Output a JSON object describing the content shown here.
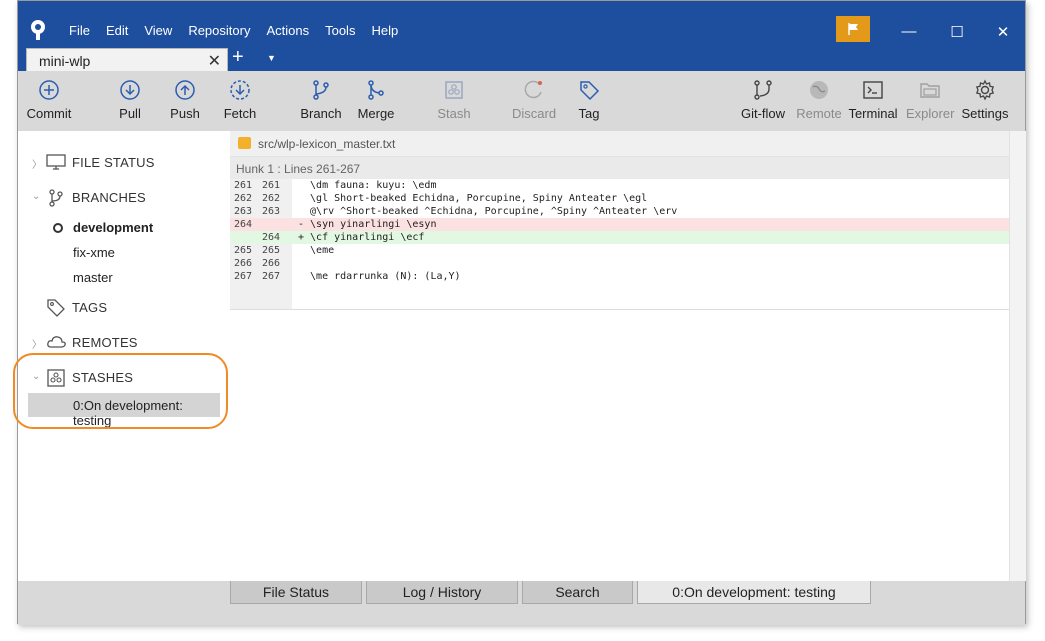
{
  "menu": [
    "File",
    "Edit",
    "View",
    "Repository",
    "Actions",
    "Tools",
    "Help"
  ],
  "window_controls": {
    "minimize": "—",
    "maximize": "☐",
    "close": "✕"
  },
  "tab": {
    "label": "mini-wlp",
    "close": "✕",
    "add": "+",
    "more": "▼"
  },
  "toolbar": [
    {
      "label": "Commit",
      "icon": "commit-icon",
      "disabled": false
    },
    {
      "label": "Pull",
      "icon": "pull-icon",
      "disabled": false
    },
    {
      "label": "Push",
      "icon": "push-icon",
      "disabled": false
    },
    {
      "label": "Fetch",
      "icon": "fetch-icon",
      "disabled": false
    },
    {
      "label": "Branch",
      "icon": "branch-icon",
      "disabled": false
    },
    {
      "label": "Merge",
      "icon": "merge-icon",
      "disabled": false
    },
    {
      "label": "Stash",
      "icon": "stash-icon",
      "disabled": true
    },
    {
      "label": "Discard",
      "icon": "discard-icon",
      "disabled": true
    },
    {
      "label": "Tag",
      "icon": "tag-icon",
      "disabled": false
    },
    {
      "label": "Git-flow",
      "icon": "git-flow-icon",
      "disabled": false
    },
    {
      "label": "Remote",
      "icon": "remote-icon",
      "disabled": true
    },
    {
      "label": "Terminal",
      "icon": "terminal-icon",
      "disabled": false
    },
    {
      "label": "Explorer",
      "icon": "explorer-icon",
      "disabled": true
    },
    {
      "label": "Settings",
      "icon": "gear-icon",
      "disabled": false
    }
  ],
  "sidebar": {
    "file_status": "FILE STATUS",
    "branches": "BRANCHES",
    "branch_list": [
      "development",
      "fix-xme",
      "master"
    ],
    "current_branch": "development",
    "tags": "TAGS",
    "remotes": "REMOTES",
    "stashes": "STASHES",
    "stash_list": [
      "0:On development: testing"
    ]
  },
  "diff": {
    "file_path": "src/wlp-lexicon_master.txt",
    "hunk": "Hunk 1 : Lines 261-267",
    "lines": [
      {
        "old": "261",
        "new": "261",
        "type": "context",
        "text": "  \\dm fauna: kuyu: \\edm"
      },
      {
        "old": "262",
        "new": "262",
        "type": "context",
        "text": "  \\gl Short-beaked Echidna, Porcupine, Spiny Anteater \\egl"
      },
      {
        "old": "263",
        "new": "263",
        "type": "context",
        "text": "  @\\rv ^Short-beaked ^Echidna, Porcupine, ^Spiny ^Anteater \\erv"
      },
      {
        "old": "264",
        "new": "",
        "type": "removed",
        "text": "- \\syn yinarlingi \\esyn"
      },
      {
        "old": "",
        "new": "264",
        "type": "added",
        "text": "+ \\cf yinarlingi \\ecf"
      },
      {
        "old": "265",
        "new": "265",
        "type": "context",
        "text": "  \\eme"
      },
      {
        "old": "266",
        "new": "266",
        "type": "context",
        "text": ""
      },
      {
        "old": "267",
        "new": "267",
        "type": "context",
        "text": "  \\me rdarrunka (N): (La,Y)"
      }
    ]
  },
  "bottom_tabs": [
    "File Status",
    "Log / History",
    "Search",
    "0:On development: testing"
  ],
  "colors": {
    "accent": "#1e4e9e",
    "flag": "#e39a1a",
    "highlight": "#f08a24",
    "removed": "#fbe1e1",
    "added": "#e2f8e2"
  }
}
